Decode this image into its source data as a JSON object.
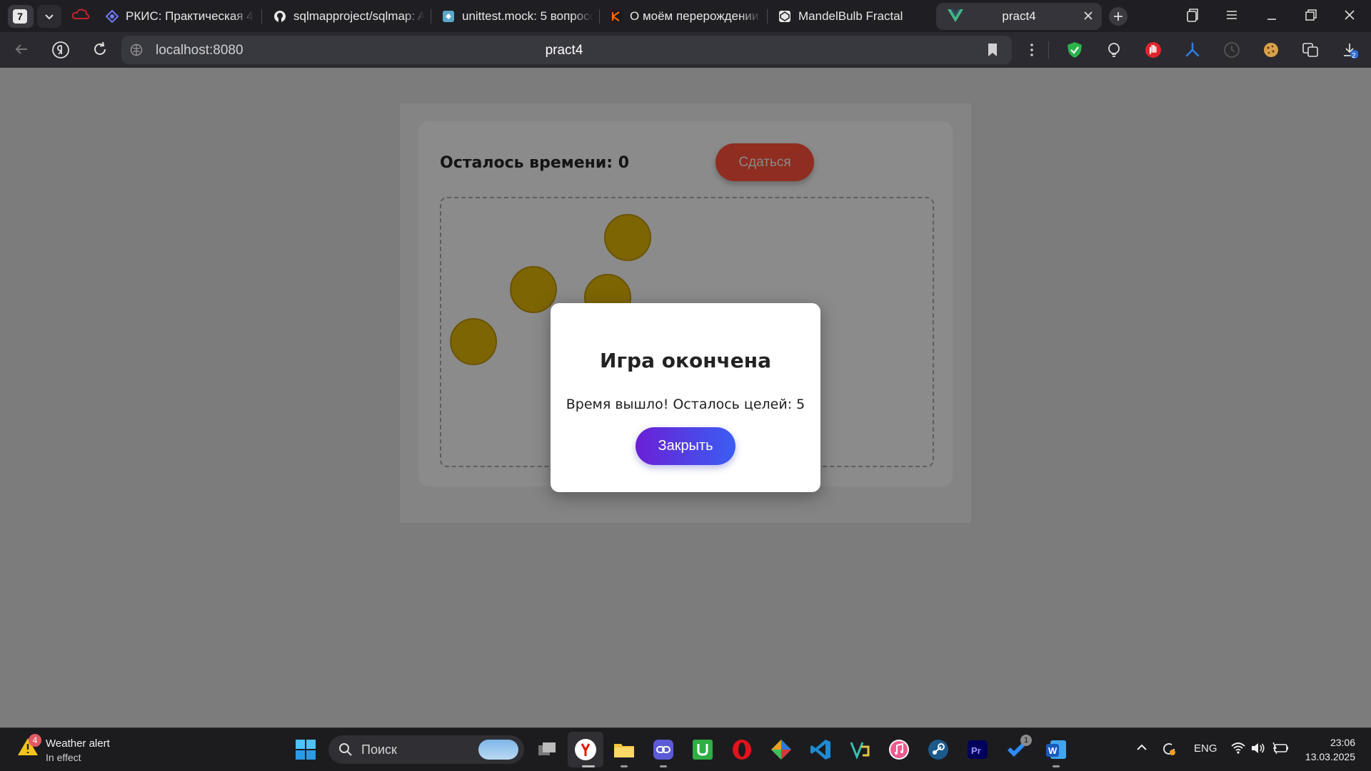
{
  "browser": {
    "tab_count": "7",
    "tabs": [
      {
        "label": "РКИС: Практическая 4",
        "icon": "cube-icon"
      },
      {
        "label": "sqlmapproject/sqlmap: Autom",
        "icon": "github-icon"
      },
      {
        "label": "unittest.mock: 5 вопросов",
        "icon": "mock-icon"
      },
      {
        "label": "О моём перерождении в",
        "icon": "kinopoisk-icon"
      },
      {
        "label": "MandelBulb Fractal",
        "icon": "codepen-icon"
      }
    ],
    "active_tab": {
      "label": "pract4",
      "icon": "vue-icon"
    },
    "url": "localhost:8080",
    "page_title": "pract4",
    "download_badge": "2"
  },
  "game": {
    "timer_text": "Осталось времени: 0",
    "surrender_label": "Сдаться",
    "target_color": "#7d6503",
    "targets_count": 5
  },
  "modal": {
    "title": "Игра окончена",
    "message": "Время вышло! Осталось целей: 5",
    "close_label": "Закрыть"
  },
  "taskbar": {
    "weather_badge": "4",
    "weather_title": "Weather alert",
    "weather_sub": "In effect",
    "search_placeholder": "Поиск",
    "apps": [
      "task-view",
      "yandex-browser",
      "file-explorer",
      "link-app",
      "utorrent",
      "opera",
      "git-app",
      "vscode",
      "vs-app",
      "itunes",
      "steam",
      "premiere-pro",
      "todo-app",
      "word"
    ],
    "todo_badge": "1",
    "language": "ENG",
    "time": "23:06",
    "date": "13.03.2025"
  }
}
